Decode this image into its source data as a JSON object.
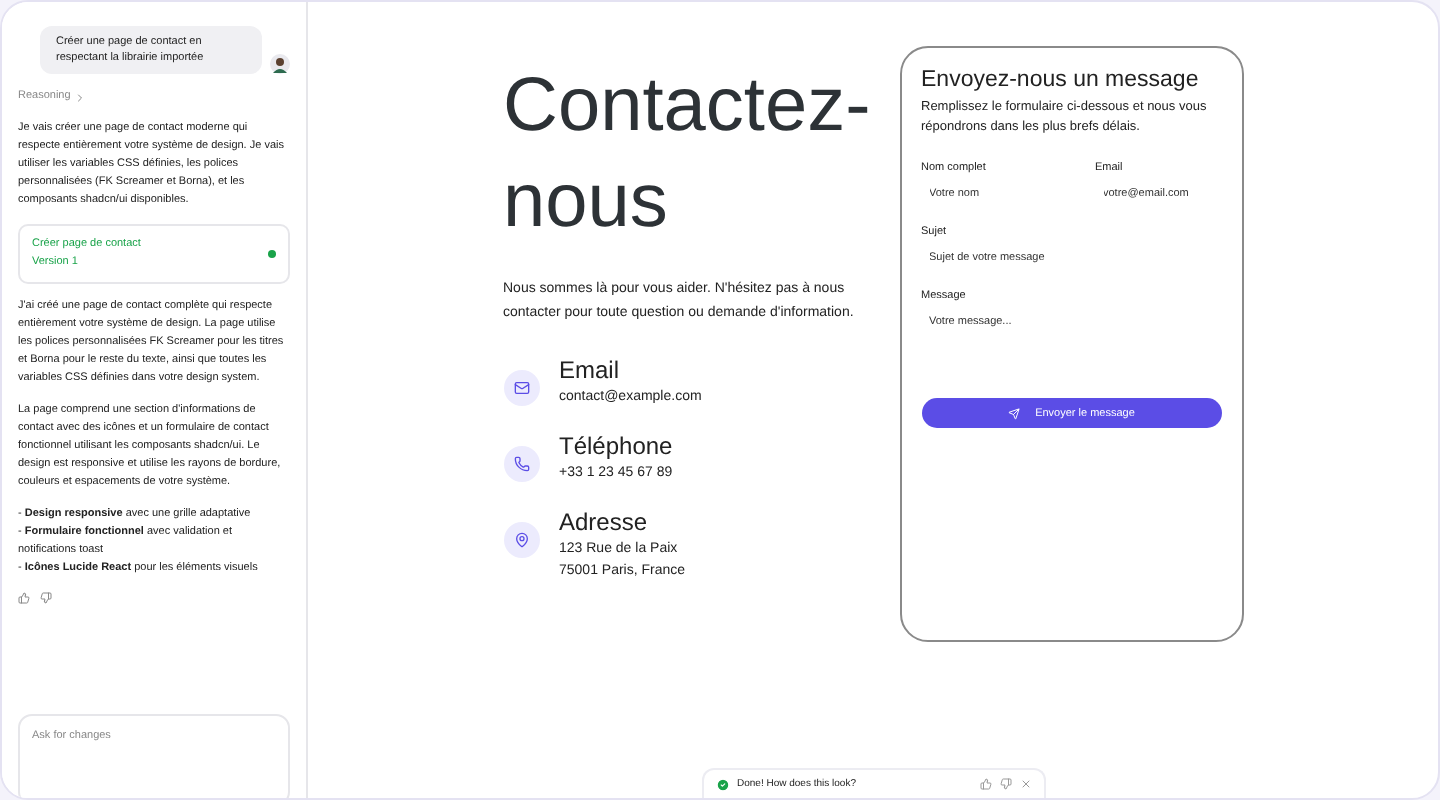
{
  "chat": {
    "user_message": "Créer une page de contact en respectant la librairie importée",
    "reasoning_label": "Reasoning",
    "intro": "Je vais créer une page de contact moderne qui respecte entièrement votre système de design. Je vais utiliser les variables CSS définies, les polices personnalisées (FK Screamer et Borna), et les composants shadcn/ui disponibles.",
    "version_card": {
      "title": "Créer page de contact",
      "version": "Version 1",
      "done": true
    },
    "paragraphs": [
      "J'ai créé une page de contact complète qui respecte entièrement votre système de design. La page utilise les polices personnalisées FK Screamer pour les titres et Borna pour le reste du texte, ainsi que toutes les variables CSS définies dans votre design system.",
      "La page comprend une section d'informations de contact avec des icônes et un formulaire de contact fonctionnel utilisant les composants shadcn/ui. Le design est responsive et utilise les rayons de bordure, couleurs et espacements de votre système."
    ],
    "bullets": [
      "- **Design responsive** avec une grille adaptative",
      "- **Formulaire fonctionnel** avec validation et notifications toast",
      "- **Icônes Lucide React** pour les éléments visuels"
    ],
    "input": {
      "placeholder": "Ask for changes"
    }
  },
  "page": {
    "heading": "Contactez-nous",
    "lead": "Nous sommes là pour vous aider. N'hésitez pas à nous contacter pour toute question ou demande d'information.",
    "contacts": [
      {
        "kind": "email",
        "title": "Email",
        "lines": [
          "contact@example.com"
        ]
      },
      {
        "kind": "phone",
        "title": "Téléphone",
        "lines": [
          "+33 1 23 45 67 89"
        ]
      },
      {
        "kind": "address",
        "title": "Adresse",
        "lines": [
          "123 Rue de la Paix",
          "75001 Paris, France"
        ]
      }
    ],
    "form": {
      "title": "Envoyez-nous un message",
      "subtitle": "Remplissez le formulaire ci-dessous et nous vous répondrons dans les plus brefs délais.",
      "fields": [
        {
          "label": "Nom complet",
          "placeholder": "Votre nom",
          "kind": "half"
        },
        {
          "label": "Email",
          "placeholder": "votre@email.com",
          "kind": "half"
        },
        {
          "label": "Sujet",
          "placeholder": "Sujet de votre message",
          "kind": "full"
        },
        {
          "label": "Message",
          "placeholder": "Votre message...",
          "kind": "area"
        }
      ],
      "submit": "Envoyer le message"
    }
  },
  "toast": {
    "text": "Done! How does this look?"
  }
}
